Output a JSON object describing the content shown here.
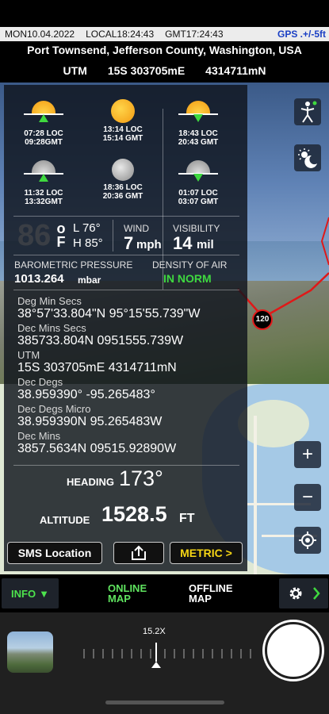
{
  "status": {
    "date": "MON10.04.2022",
    "local": "LOCAL18:24:43",
    "gmt": "GMT17:24:43",
    "gps": "GPS .+/-5ft"
  },
  "location": "Port Townsend, Jefferson County, Washington, USA",
  "utm_header": {
    "label": "UTM",
    "zone": "15S 303705mE",
    "northing": "4314711mN"
  },
  "astro": {
    "sunrise": {
      "loc": "07:28 LOC",
      "gmt": "09:28GMT"
    },
    "sun_noon": {
      "loc": "13:14 LOC",
      "gmt": "15:14 GMT"
    },
    "sunset": {
      "loc": "18:43 LOC",
      "gmt": "20:43 GMT"
    },
    "moonrise": {
      "loc": "11:32 LOC",
      "gmt": "13:32GMT"
    },
    "moon_transit": {
      "loc": "18:36 LOC",
      "gmt": "20:36 GMT"
    },
    "moonset": {
      "loc": "01:07 LOC",
      "gmt": "03:07 GMT"
    }
  },
  "weather": {
    "temp": "86",
    "unit_deg": "o",
    "unit_f": "F",
    "low": "L 76°",
    "high": "H 85°",
    "wind_label": "WIND",
    "wind_value": "7",
    "wind_unit": "mph",
    "visibility_label": "VISIBILITY",
    "visibility_value": "14",
    "visibility_unit": "mil",
    "pressure_label": "BAROMETRIC PRESSURE",
    "pressure_value": "1013.264",
    "pressure_unit": "mbar",
    "density_label": "DENSITY OF AIR",
    "density_value": "IN NORM"
  },
  "coords": [
    {
      "label": "Deg Min Secs",
      "value": "38°57'33.804\"N 95°15'55.739\"W"
    },
    {
      "label": "Dec Mins Secs",
      "value": "385733.804N  0951555.739W"
    },
    {
      "label": "UTM",
      "value": "15S 303705mE   4314711mN"
    },
    {
      "label": "Dec Degs",
      "value": "38.959390°   -95.265483°"
    },
    {
      "label": "Dec Degs Micro",
      "value": "38.959390N   95.265483W"
    },
    {
      "label": "Dec Mins",
      "value": "3857.5634N 09515.92890W"
    }
  ],
  "heading": {
    "label": "HEADING",
    "value": "173°"
  },
  "altitude": {
    "label": "ALTITUDE",
    "value": "1528.5",
    "unit": "FT"
  },
  "buttons": {
    "sms": "SMS  Location",
    "metric": "METRIC >"
  },
  "map": {
    "speed_sign": "120"
  },
  "tabs": {
    "info": "INFO",
    "online": "ONLINE MAP",
    "offline": "OFFLINE MAP"
  },
  "camera": {
    "zoom": "15.2X"
  }
}
